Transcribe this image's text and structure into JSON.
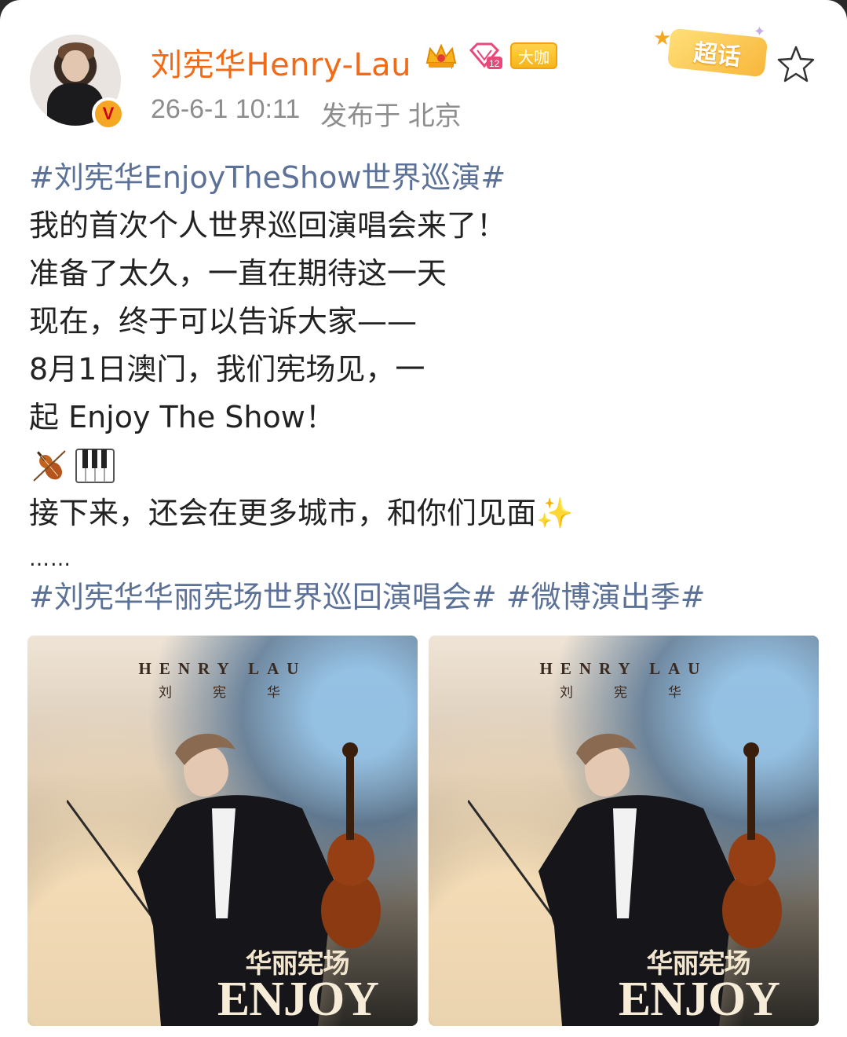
{
  "post": {
    "author": "刘宪华Henry-Lau",
    "verified_mark": "V",
    "badge_label": "大咖",
    "supertopic_label": "超话",
    "time": "26-6-1 10:11",
    "location": "发布于 北京"
  },
  "body": {
    "hashtag_top": "#刘宪华EnjoyTheShow世界巡演#",
    "lines": [
      "我的首次个人世界巡回演唱会来了！",
      "准备了太久，一直在期待这一天",
      "现在，终于可以告诉大家——",
      "8月1日澳门，我们宪场见，一",
      "起 Enjoy The Show！"
    ],
    "emoji_row": [
      "violin-emoji",
      "piano-emoji"
    ],
    "line_after": "接下来，还会在更多城市，和你们见面✨",
    "ellipsis": "……",
    "hashtag_bottom_1": "#刘宪华华丽宪场世界巡回演唱会#",
    "hashtag_bottom_2": "#微博演出季#"
  },
  "images": [
    {
      "name_en": "HENRY LAU",
      "name_cn": "刘宪华",
      "title_cn": "华丽宪场",
      "title_en": "ENJOY"
    },
    {
      "name_en": "HENRY LAU",
      "name_cn": "刘宪华",
      "title_cn": "华丽宪场",
      "title_en": "ENJOY"
    }
  ],
  "colors": {
    "username": "#f26a16",
    "hashtag": "#5b7197",
    "meta": "#8d8d8d",
    "text": "#222222"
  }
}
